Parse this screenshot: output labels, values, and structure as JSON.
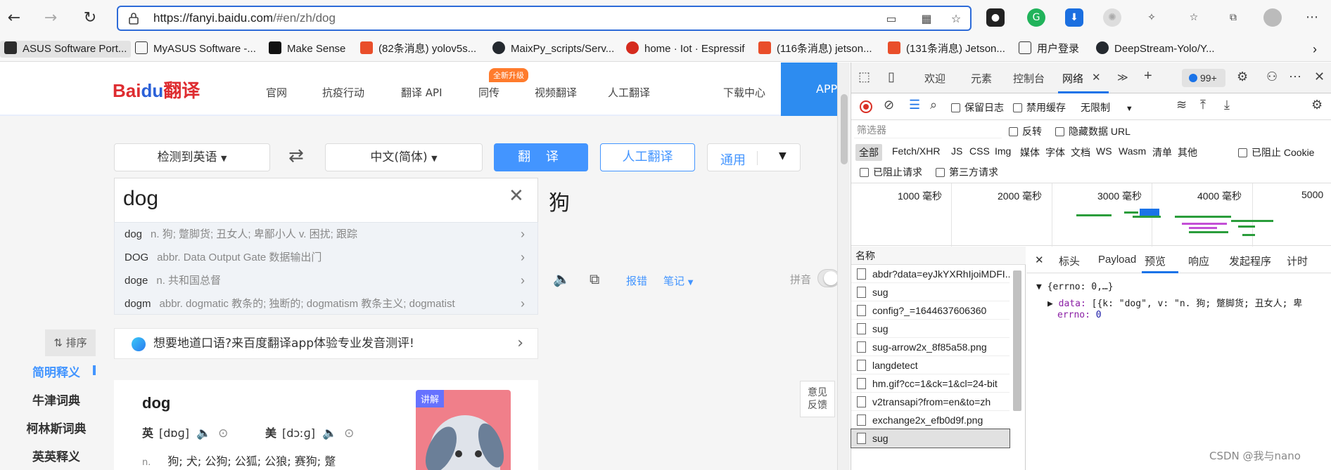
{
  "browser": {
    "url_host": "https://fanyi.baidu.com",
    "url_path": "/#en/zh/dog"
  },
  "bookmarks": [
    {
      "label": "ASUS Software Port...",
      "color": "#2b2b2b"
    },
    {
      "label": "MyASUS Software -...",
      "color": "#2b2b2b"
    },
    {
      "label": "Make Sense",
      "color": "#111111"
    },
    {
      "label": "(82条消息) yolov5s...",
      "color": "#e94e2a"
    },
    {
      "label": "MaixPy_scripts/Serv...",
      "color": "#24292f"
    },
    {
      "label": "home · Iot · Espressif",
      "color": "#d52b1e"
    },
    {
      "label": "(116条消息) jetson...",
      "color": "#e94e2a"
    },
    {
      "label": "(131条消息) Jetson...",
      "color": "#e94e2a"
    },
    {
      "label": "用户登录",
      "color": "#2b2b2b"
    },
    {
      "label": "DeepStream-Yolo/Y...",
      "color": "#24292f"
    }
  ],
  "header": {
    "logo_bai": "Bai",
    "logo_du": "du",
    "logo_fanyi": "翻译",
    "nav": [
      "官网",
      "抗疫行动",
      "翻译 API",
      "同传",
      "视频翻译",
      "人工翻译",
      "下载中心"
    ],
    "badge": "全新升级",
    "app": "APP"
  },
  "translator": {
    "source_lang": "检测到英语",
    "target_lang": "中文(简体)",
    "translate_btn": "翻 译",
    "human_btn": "人工翻译",
    "domain_btn": "通用",
    "input_text": "dog",
    "result": "狗",
    "suggestions": [
      {
        "k": "dog",
        "v": "n. 狗; 蹩脚货; 丑女人; 卑鄙小人 v. 困扰; 跟踪"
      },
      {
        "k": "DOG",
        "v": "abbr. Data Output Gate 数据输出门"
      },
      {
        "k": "doge",
        "v": "n. 共和国总督"
      },
      {
        "k": "dogm",
        "v": "abbr. dogmatic 教条的; 独断的; dogmatism 教条主义; dogmatist"
      }
    ],
    "report": "报错",
    "notes": "笔记",
    "pinyin": "拼音"
  },
  "sidebar": {
    "sort": "排序",
    "items": [
      "简明释义",
      "牛津词典",
      "柯林斯词典",
      "英英释义"
    ]
  },
  "promo": "想要地道口语?来百度翻译app体验专业发音测评!",
  "dict": {
    "word": "dog",
    "uk_label": "英",
    "uk_phon": "[dɒɡ]",
    "us_label": "美",
    "us_phon": "[dɔːɡ]",
    "pos": "n.",
    "meaning": "狗; 犬; 公狗; 公狐; 公狼; 赛狗; 蹩",
    "thumb_tag": "讲解"
  },
  "feedback": [
    "意见",
    "反馈"
  ],
  "devtools": {
    "tabs": [
      "欢迎",
      "元素",
      "控制台",
      "网络",
      "≫",
      "+"
    ],
    "badge": "99+",
    "toolbar": {
      "preserve_log": "保留日志",
      "disable_cache": "禁用缓存",
      "throttle": "无限制"
    },
    "filter_placeholder": "筛选器",
    "invert": "反转",
    "hide_data_url": "隐藏数据 URL",
    "types": [
      "全部",
      "Fetch/XHR",
      "JS",
      "CSS",
      "Img",
      "媒体",
      "字体",
      "文档",
      "WS",
      "Wasm",
      "清单",
      "其他"
    ],
    "blocked_cookie": "已阻止 Cookie",
    "blocked_requests": "已阻止请求",
    "third_party": "第三方请求",
    "timeline_labels": [
      "1000 毫秒",
      "2000 毫秒",
      "3000 毫秒",
      "4000 毫秒",
      "5000"
    ],
    "name_header": "名称",
    "requests": [
      "abdr?data=eyJkYXRhIjoiMDFI...",
      "sug",
      "config?_=1644637606360",
      "sug",
      "sug-arrow2x_8f85a58.png",
      "langdetect",
      "hm.gif?cc=1&ck=1&cl=24-bit",
      "v2transapi?from=en&to=zh",
      "exchange2x_efb0d9f.png",
      "sug"
    ],
    "detail_tabs": [
      "标头",
      "Payload",
      "预览",
      "响应",
      "发起程序",
      "计时"
    ],
    "preview_line1": "{errno: 0,…}",
    "preview_data_key": "data:",
    "preview_data_val": "[{k: \"dog\", v: \"n. 狗; 蹩脚货; 丑女人; 卑",
    "preview_errno_key": "errno:",
    "preview_errno_val": "0"
  },
  "watermark": "CSDN @我与nano"
}
